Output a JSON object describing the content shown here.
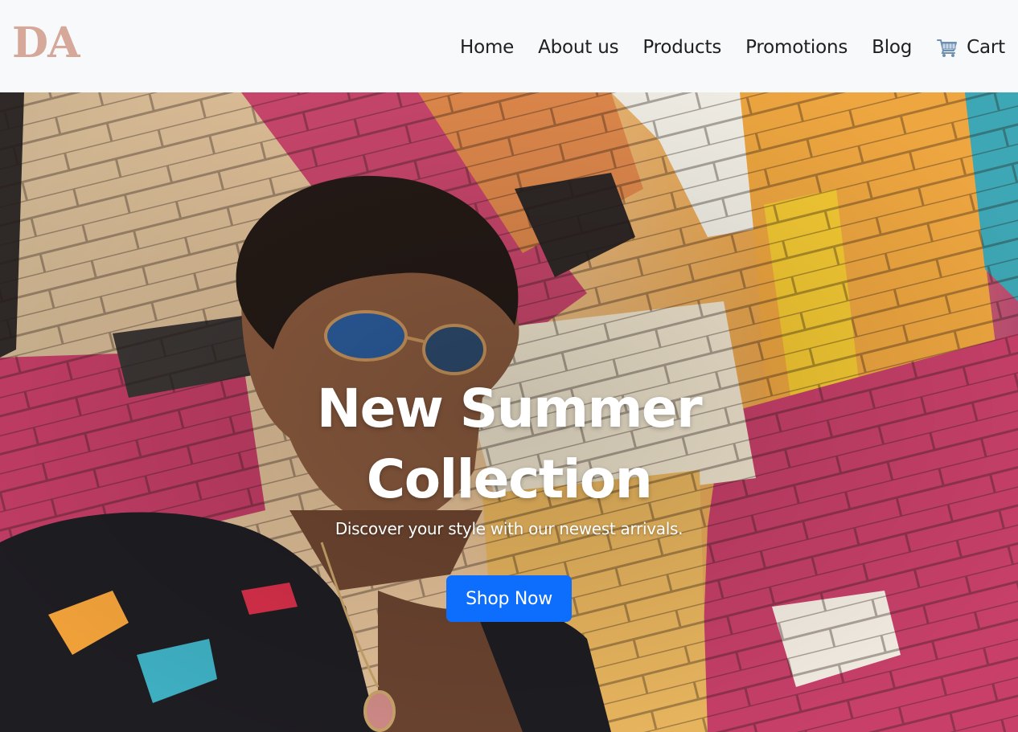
{
  "brand": {
    "logo_text": "DA",
    "logo_color": "#d6a89a"
  },
  "nav": {
    "items": [
      {
        "label": "Home"
      },
      {
        "label": "About us"
      },
      {
        "label": "Products"
      },
      {
        "label": "Promotions"
      },
      {
        "label": "Blog"
      }
    ],
    "cart": {
      "label": "Cart",
      "icon": "shopping-cart-icon"
    }
  },
  "hero": {
    "title_line1": "New Summer",
    "title_line2": "Collection",
    "subtitle": "Discover your style with our newest arrivals.",
    "cta_label": "Shop Now",
    "cta_color": "#0d6efd",
    "background": "photo-of-person-in-sunglasses-leaning-on-graffiti-brick-wall"
  }
}
